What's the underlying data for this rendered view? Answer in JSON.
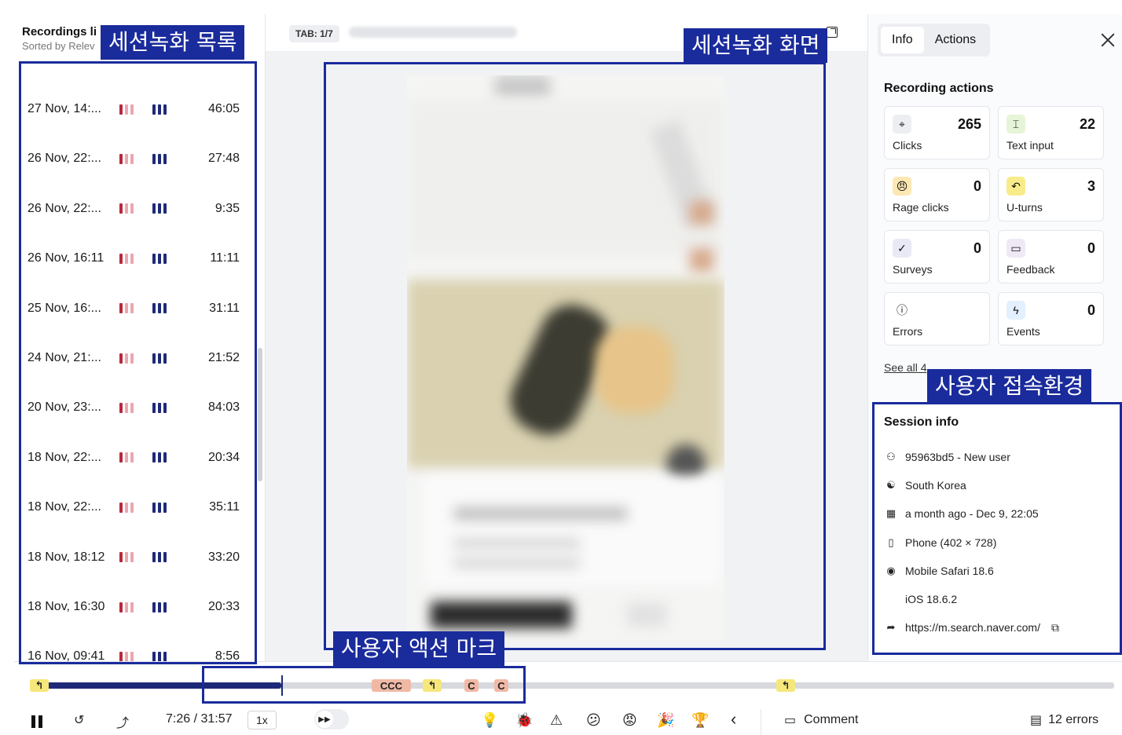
{
  "recordings": {
    "title": "Recordings li",
    "sort": "Sorted by Relev",
    "items": [
      {
        "date": "27 Nov, 14:...",
        "duration": "46:05"
      },
      {
        "date": "26 Nov, 22:...",
        "duration": "27:48"
      },
      {
        "date": "26 Nov, 22:...",
        "duration": "9:35"
      },
      {
        "date": "26 Nov, 16:11",
        "duration": "11:11"
      },
      {
        "date": "25 Nov, 16:...",
        "duration": "31:11"
      },
      {
        "date": "24 Nov, 21:...",
        "duration": "21:52"
      },
      {
        "date": "20 Nov, 23:...",
        "duration": "84:03"
      },
      {
        "date": "18 Nov, 22:...",
        "duration": "20:34"
      },
      {
        "date": "18 Nov, 22:...",
        "duration": "35:11"
      },
      {
        "date": "18 Nov, 18:12",
        "duration": "33:20"
      },
      {
        "date": "18 Nov, 16:30",
        "duration": "20:33"
      },
      {
        "date": "16 Nov, 09:41",
        "duration": "8:56"
      }
    ]
  },
  "player": {
    "tab_badge": "TAB: 1/7"
  },
  "info_panel": {
    "tabs": [
      "Info",
      "Actions"
    ],
    "recording_actions_title": "Recording actions",
    "actions": [
      {
        "label": "Clicks",
        "count": "265",
        "icon": "cursor-click-icon",
        "color": "#eceef1"
      },
      {
        "label": "Text input",
        "count": "22",
        "icon": "text-input-icon",
        "color": "#e6f5d8"
      },
      {
        "label": "Rage clicks",
        "count": "0",
        "icon": "rage-face-icon",
        "color": "#fde7b3"
      },
      {
        "label": "U-turns",
        "count": "3",
        "icon": "u-turn-icon",
        "color": "#f8ec8a"
      },
      {
        "label": "Surveys",
        "count": "0",
        "icon": "clipboard-check-icon",
        "color": "#e8e9f5"
      },
      {
        "label": "Feedback",
        "count": "0",
        "icon": "message-icon",
        "color": "#efe8f5"
      },
      {
        "label": "Errors",
        "count": "",
        "icon": "alert-circle-icon",
        "color": "#ffffff"
      },
      {
        "label": "Events",
        "count": "0",
        "icon": "lightning-icon",
        "color": "#e2f0ff"
      }
    ],
    "see_all": "See all 4",
    "session_info_title": "Session info",
    "session": [
      {
        "icon": "user-icon",
        "text": "95963bd5 - New user"
      },
      {
        "icon": "korea-flag-icon",
        "text": "South Korea"
      },
      {
        "icon": "calendar-icon",
        "text": "a month ago - Dec 9, 22:05"
      },
      {
        "icon": "phone-icon",
        "text": "Phone (402 × 728)"
      },
      {
        "icon": "safari-icon",
        "text": "Mobile Safari 18.6"
      },
      {
        "icon": "apple-icon",
        "text": "iOS 18.6.2"
      },
      {
        "icon": "share-arrow-icon",
        "text": "https://m.search.naver.com/"
      }
    ]
  },
  "timeline": {
    "time": "7:26 / 31:57",
    "speed": "1x",
    "comment_label": "Comment",
    "errors_label": "12 errors"
  },
  "annotations": {
    "list": "세션녹화 목록",
    "screen": "세션녹화 화면",
    "env": "사용자 접속환경",
    "marks": "사용자 액션 마크"
  }
}
